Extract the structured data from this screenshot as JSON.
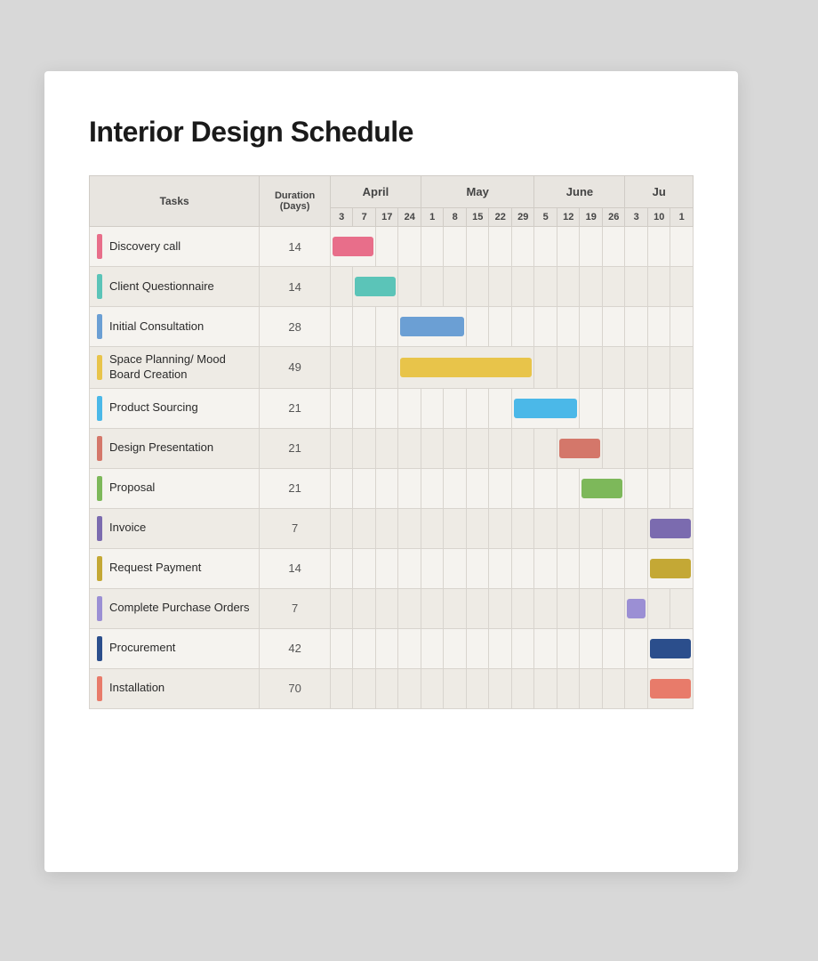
{
  "title": "Interior Design Schedule",
  "table": {
    "headers": {
      "tasks": "Tasks",
      "duration": "Duration\n(Days)"
    },
    "months": [
      {
        "name": "April",
        "dates": [
          3,
          7,
          17,
          24
        ]
      },
      {
        "name": "May",
        "dates": [
          1,
          8,
          15,
          22,
          29
        ]
      },
      {
        "name": "June",
        "dates": [
          5,
          12,
          19,
          26
        ]
      },
      {
        "name": "Ju",
        "dates": [
          3,
          10,
          1
        ]
      }
    ],
    "rows": [
      {
        "name": "Discovery call",
        "duration": 14,
        "color": "#E86E8A",
        "barStart": 0,
        "barWidth": 2
      },
      {
        "name": "Client Questionnaire",
        "duration": 14,
        "color": "#5BC4B8",
        "barStart": 1,
        "barWidth": 2
      },
      {
        "name": "Initial Consultation",
        "duration": 28,
        "color": "#6B9FD4",
        "barStart": 3,
        "barWidth": 3
      },
      {
        "name": "Space Planning/\nMood Board Creation",
        "duration": 49,
        "color": "#E8C44A",
        "barStart": 4,
        "barWidth": 5
      },
      {
        "name": "Product Sourcing",
        "duration": 21,
        "color": "#4BB8E8",
        "barStart": 8,
        "barWidth": 3
      },
      {
        "name": "Design Presentation",
        "duration": 21,
        "color": "#D4776A",
        "barStart": 10,
        "barWidth": 3
      },
      {
        "name": "Proposal",
        "duration": 21,
        "color": "#7DB85A",
        "barStart": 11,
        "barWidth": 3
      },
      {
        "name": "Invoice",
        "duration": 7,
        "color": "#7B6BAF",
        "barStart": 14,
        "barWidth": 1
      },
      {
        "name": "Request Payment",
        "duration": 14,
        "color": "#C4A835",
        "barStart": 14,
        "barWidth": 1
      },
      {
        "name": "Complete Purchase Orders",
        "duration": 7,
        "color": "#9B8FD4",
        "barStart": 13,
        "barWidth": 1
      },
      {
        "name": "Procurement",
        "duration": 42,
        "color": "#2B4E8C",
        "barStart": 14,
        "barWidth": 1
      },
      {
        "name": "Installation",
        "duration": 70,
        "color": "#E87B6A",
        "barStart": 14,
        "barWidth": 1
      }
    ]
  }
}
